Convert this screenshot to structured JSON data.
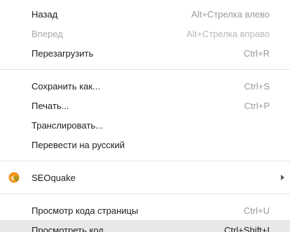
{
  "menu": {
    "groups": [
      {
        "items": [
          {
            "label": "Назад",
            "shortcut": "Alt+Стрелка влево",
            "enabled": true
          },
          {
            "label": "Вперед",
            "shortcut": "Alt+Стрелка вправо",
            "enabled": false
          },
          {
            "label": "Перезагрузить",
            "shortcut": "Ctrl+R",
            "enabled": true
          }
        ]
      },
      {
        "items": [
          {
            "label": "Сохранить как...",
            "shortcut": "Ctrl+S",
            "enabled": true
          },
          {
            "label": "Печать...",
            "shortcut": "Ctrl+P",
            "enabled": true
          },
          {
            "label": "Транслировать...",
            "shortcut": "",
            "enabled": true
          },
          {
            "label": "Перевести на русский",
            "shortcut": "",
            "enabled": true
          }
        ]
      },
      {
        "items": [
          {
            "label": "SEOquake",
            "shortcut": "",
            "enabled": true,
            "icon": "seoquake-icon",
            "has_submenu": true
          }
        ]
      },
      {
        "items": [
          {
            "label": "Просмотр кода страницы",
            "shortcut": "Ctrl+U",
            "enabled": true
          },
          {
            "label": "Просмотреть код",
            "shortcut": "Ctrl+Shift+I",
            "enabled": true,
            "highlighted": true
          }
        ]
      }
    ]
  },
  "colors": {
    "background": "#ffffff",
    "text": "#1e1e1e",
    "disabled_text": "#a8a8a8",
    "shortcut_text": "#9a9a9a",
    "highlight": "#e8e8e8",
    "separator": "#e2e2e2",
    "seoquake_orange": "#f08a10",
    "seoquake_green": "#3f9a2a"
  }
}
